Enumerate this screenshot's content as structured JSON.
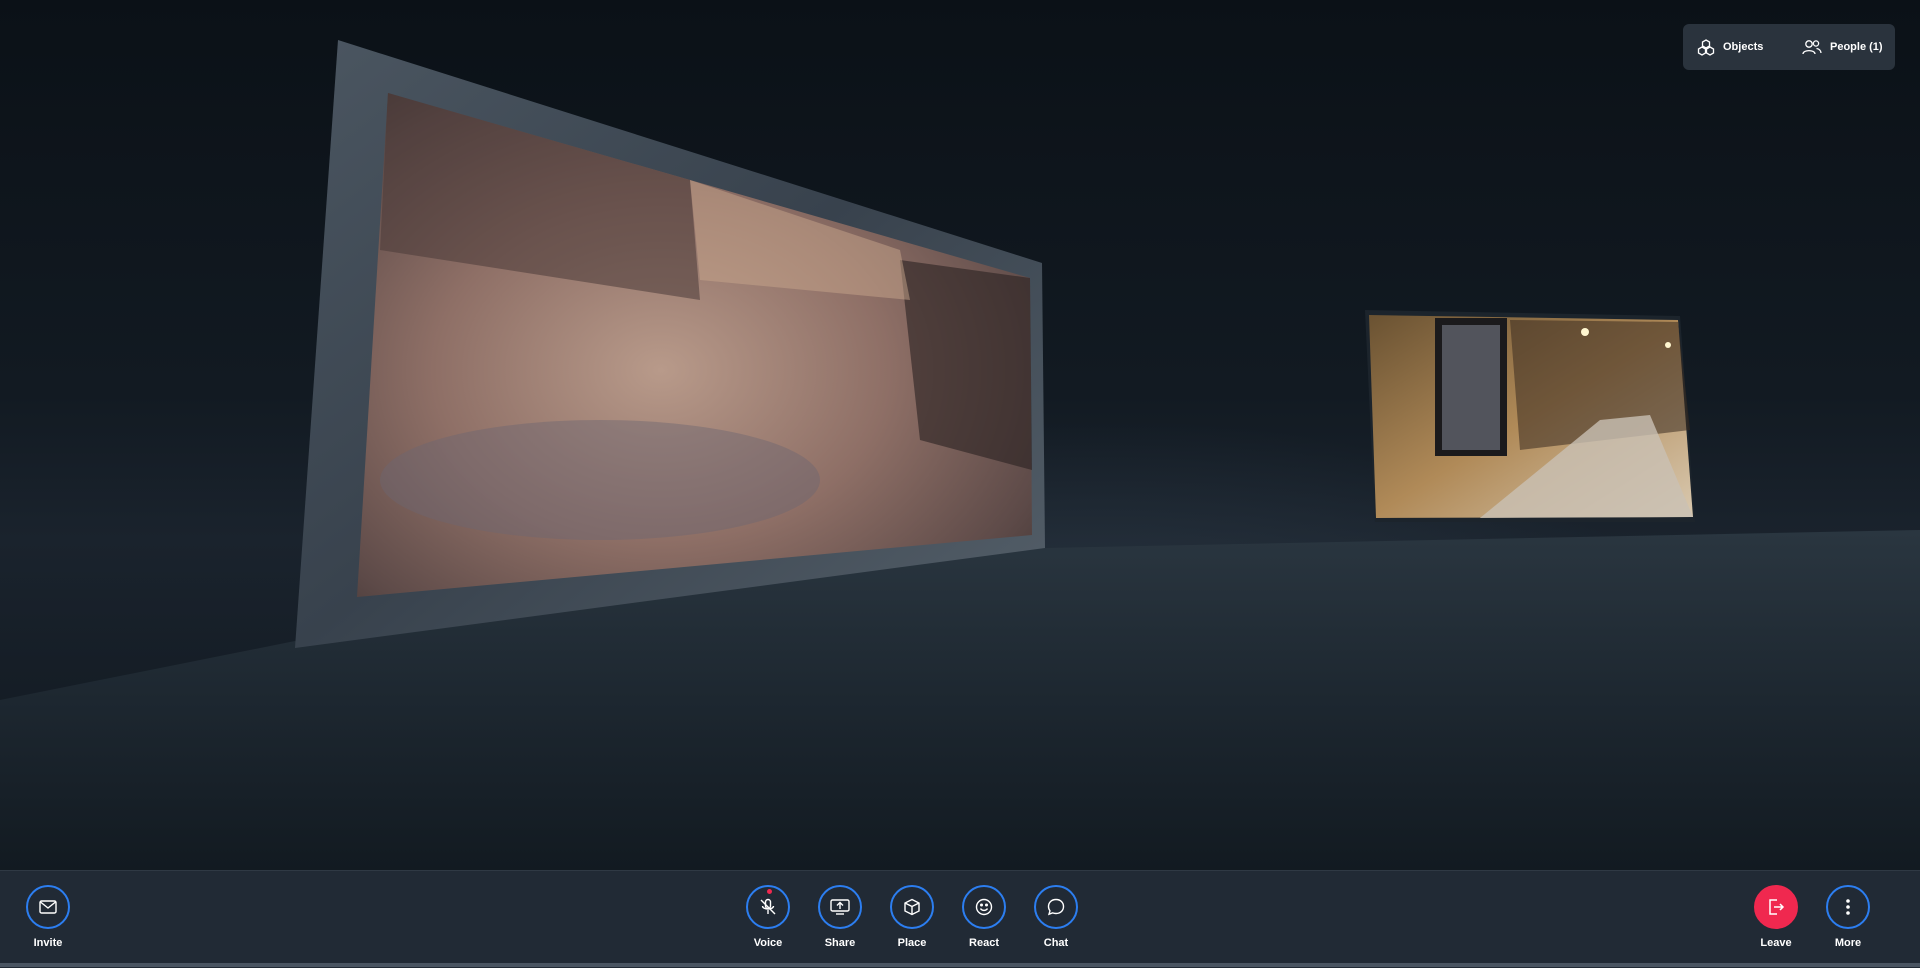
{
  "top_panel": {
    "objects_label": "Objects",
    "people_label": "People (1)"
  },
  "toolbar": {
    "invite_label": "Invite",
    "voice_label": "Voice",
    "share_label": "Share",
    "place_label": "Place",
    "react_label": "React",
    "chat_label": "Chat",
    "leave_label": "Leave",
    "more_label": "More"
  },
  "icons": {
    "objects": "objects-icon",
    "people": "people-icon",
    "invite": "envelope-icon",
    "voice": "microphone-muted-icon",
    "share": "screen-share-icon",
    "place": "cube-icon",
    "react": "smiley-icon",
    "chat": "chat-bubble-icon",
    "leave": "leave-door-icon",
    "more": "kebab-menu-icon"
  },
  "colors": {
    "accent": "#2c7ef1",
    "leave": "#f0284f",
    "toolbar_bg": "#212a35",
    "panel_bg": "#2a333d"
  }
}
